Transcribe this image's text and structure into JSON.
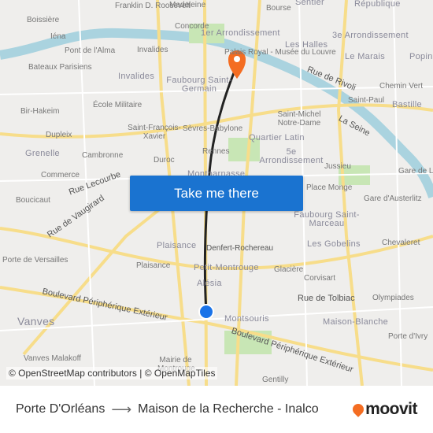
{
  "map": {
    "labels": [
      "Boissière",
      "Iéna",
      "Franklin D. Roosevelt",
      "Madeleine",
      "Concorde",
      "1er Arrondissement",
      "Bourse",
      "Sentier",
      "République",
      "3e Arrondissement",
      "Palais Royal - Musée du Louvre",
      "Les Halles",
      "Le Marais",
      "Popincourt",
      "Pont de l'Alma",
      "Invalides",
      "Bateaux Parisiens",
      "Invalides",
      "Faubourg Saint-Germain",
      "Rue de Rivoli",
      "Chemin Vert",
      "Saint-Paul",
      "Bastille",
      "Bir-Hakeim",
      "École Militaire",
      "Saint-Michel Notre-Dame",
      "La Seine",
      "Dupleix",
      "Saint-François-Xavier",
      "Sèvres-Babylone",
      "Quartier Latin",
      "Grenelle",
      "Cambronne",
      "Rennes",
      "5e Arrondissement",
      "Jussieu",
      "Commerce",
      "Rue Lecourbe",
      "Duroc",
      "Montparnasse",
      "Place Monge",
      "Gare de Lyon",
      "Boucicaut",
      "Rue de Vaugirard",
      "Gare d'Austerlitz",
      "Faubourg Saint-Marceau",
      "Chevaleret",
      "Porte de Versailles",
      "Plaisance",
      "Denfert-Rochereau",
      "Les Gobelins",
      "Plaisance",
      "Petit-Montrouge",
      "Glacière",
      "Corvisart",
      "Alésia",
      "Boulevard Périphérique Extérieur",
      "Rue de Tolbiac",
      "Olympiades",
      "Vanves",
      "Montsouris",
      "Maison-Blanche",
      "Porte d'Ivry",
      "Vanves Malakoff",
      "Mairie de Montrouge",
      "Boulevard Périphérique Extérieur",
      "Gentilly"
    ],
    "route_color": "#222222",
    "origin_color": "#1a73e8",
    "destination_color": "#f46d22"
  },
  "cta": {
    "label": "Take me there"
  },
  "attribution": "© OpenStreetMap contributors | © OpenMapTiles",
  "footer": {
    "origin": "Porte D'Orléans",
    "arrow": "⟶",
    "destination": "Maison de la Recherche - Inalco",
    "logo": "moovit"
  }
}
